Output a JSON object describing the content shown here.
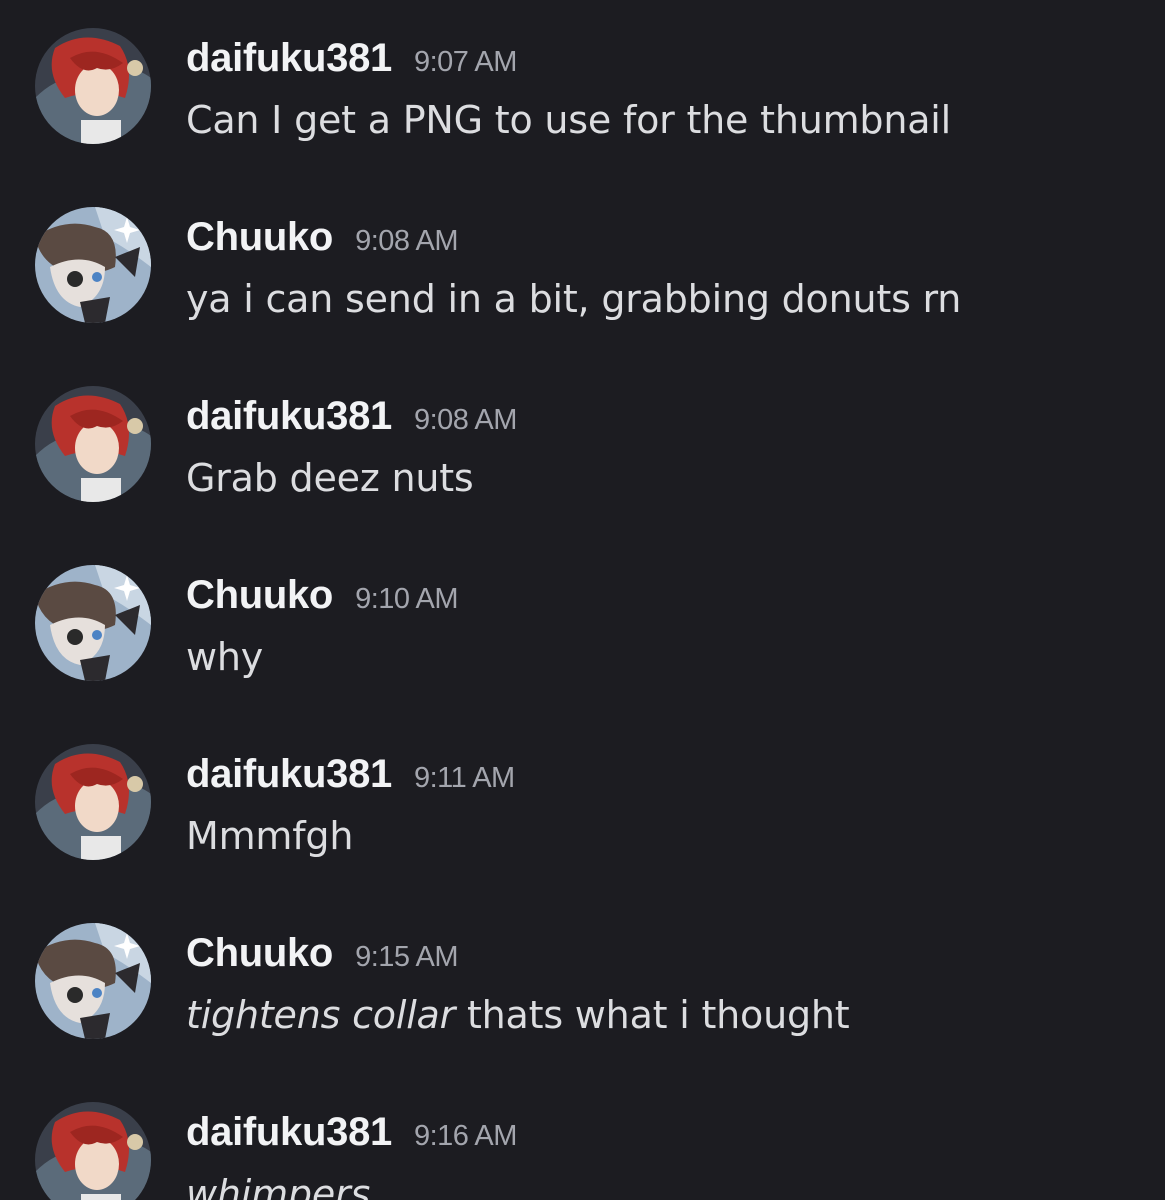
{
  "messages": [
    {
      "username": "daifuku381",
      "avatar": "daifuku-avatar",
      "time": "9:07 AM",
      "italic": "",
      "text": "Can I get a PNG to use for the thumbnail"
    },
    {
      "username": "Chuuko",
      "avatar": "chuuko-avatar",
      "time": "9:08 AM",
      "italic": "",
      "text": "ya i can send in a bit, grabbing donuts rn"
    },
    {
      "username": "daifuku381",
      "avatar": "daifuku-avatar",
      "time": "9:08 AM",
      "italic": "",
      "text": "Grab deez nuts"
    },
    {
      "username": "Chuuko",
      "avatar": "chuuko-avatar",
      "time": "9:10 AM",
      "italic": "",
      "text": "why"
    },
    {
      "username": "daifuku381",
      "avatar": "daifuku-avatar",
      "time": "9:11 AM",
      "italic": "",
      "text": "Mmmfgh"
    },
    {
      "username": "Chuuko",
      "avatar": "chuuko-avatar",
      "time": "9:15 AM",
      "italic": "tightens collar",
      "text": " thats what i thought"
    },
    {
      "username": "daifuku381",
      "avatar": "daifuku-avatar",
      "time": "9:16 AM",
      "italic": "whimpers",
      "text": ""
    }
  ]
}
